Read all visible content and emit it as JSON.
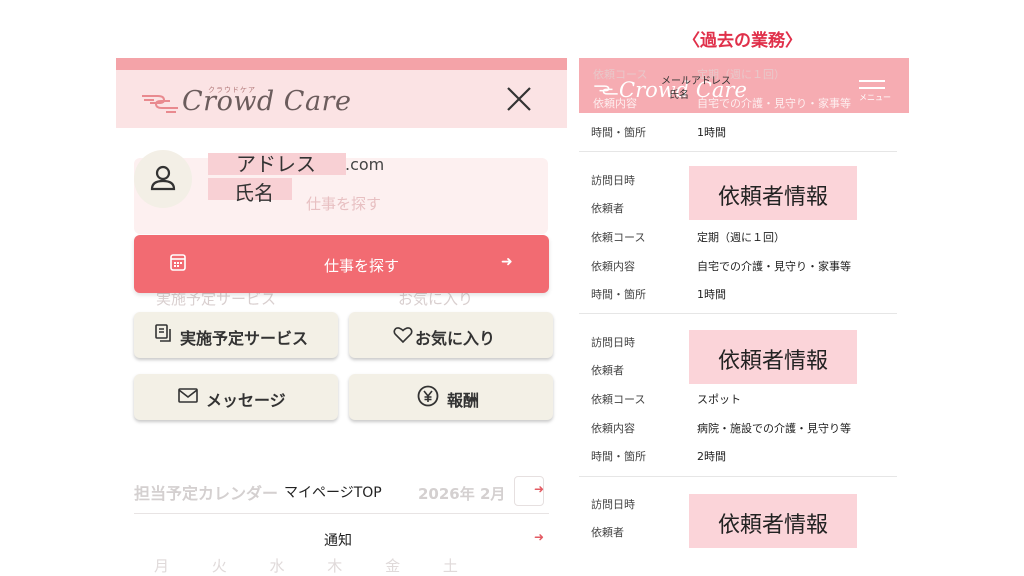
{
  "app": {
    "logo_text": "Crowd Care",
    "logo_small": "クラウドケア"
  },
  "drawer": {
    "user": {
      "address": "アドレス",
      "domain": ".com",
      "name": "氏名"
    },
    "find_job_label": "仕事を探す",
    "arrow": "➜",
    "buttons": {
      "scheduled": "実施予定サービス",
      "favorites": "お気に入り",
      "messages": "メッセージ",
      "reward": "報酬"
    },
    "links": [
      {
        "label": "マイページTOP"
      },
      {
        "label": "通知"
      }
    ],
    "background": {
      "ghost_job": "仕事を探す",
      "ghost_scheduled": "実施予定サービス",
      "ghost_fav": "お気に入り",
      "calendar_title": "担当予定カレンダー",
      "calendar_month": "2026年 2月",
      "weekdays": "月 火 水 木 金 土"
    }
  },
  "past_jobs": {
    "title": "〈過去の業務〉",
    "header": {
      "mail": "メールアドレス",
      "name": "氏名",
      "menu": "メニュー",
      "ghost_course_label": "依頼コース",
      "ghost_course_value": "定期（週に１回）",
      "ghost_content_label": "依頼内容",
      "ghost_content_value": "自宅での介護・見守り・家事等"
    },
    "labels": {
      "visit_time": "訪問日時",
      "requester": "依頼者",
      "course": "依頼コース",
      "content": "依頼内容",
      "time_place": "時間・箇所",
      "requester_info": "依頼者情報"
    },
    "partial_top": {
      "time_place": "1時間"
    },
    "entries": [
      {
        "course": "定期（週に１回）",
        "content": "自宅での介護・見守り・家事等",
        "time": "1時間"
      },
      {
        "course": "スポット",
        "content": "病院・施設での介護・見守り等",
        "time": "2時間"
      }
    ]
  },
  "colors": {
    "accent": "#f26b72",
    "title_red": "#e0304a",
    "highlight": "#fbd4d9"
  }
}
